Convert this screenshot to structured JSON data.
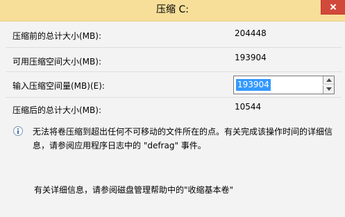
{
  "window": {
    "title": "压缩 C:"
  },
  "form": {
    "rows": [
      {
        "label": "压缩前的总计大小(MB):",
        "value": "204448"
      },
      {
        "label": "可用压缩空间大小(MB):",
        "value": "193904"
      },
      {
        "label": "输入压缩空间量(MB)(E):",
        "value": "193904"
      },
      {
        "label": "压缩后的总计大小(MB):",
        "value": "10544"
      }
    ]
  },
  "info": {
    "text": "无法将卷压缩到超出任何不可移动的文件所在的点。有关完成该操作时间的详细信息，请参阅应用程序日志中的 \"defrag\" 事件。",
    "icon": "info-icon"
  },
  "help": {
    "text": "有关详细信息，请参阅磁盘管理帮助中的\"收缩基本卷\""
  }
}
